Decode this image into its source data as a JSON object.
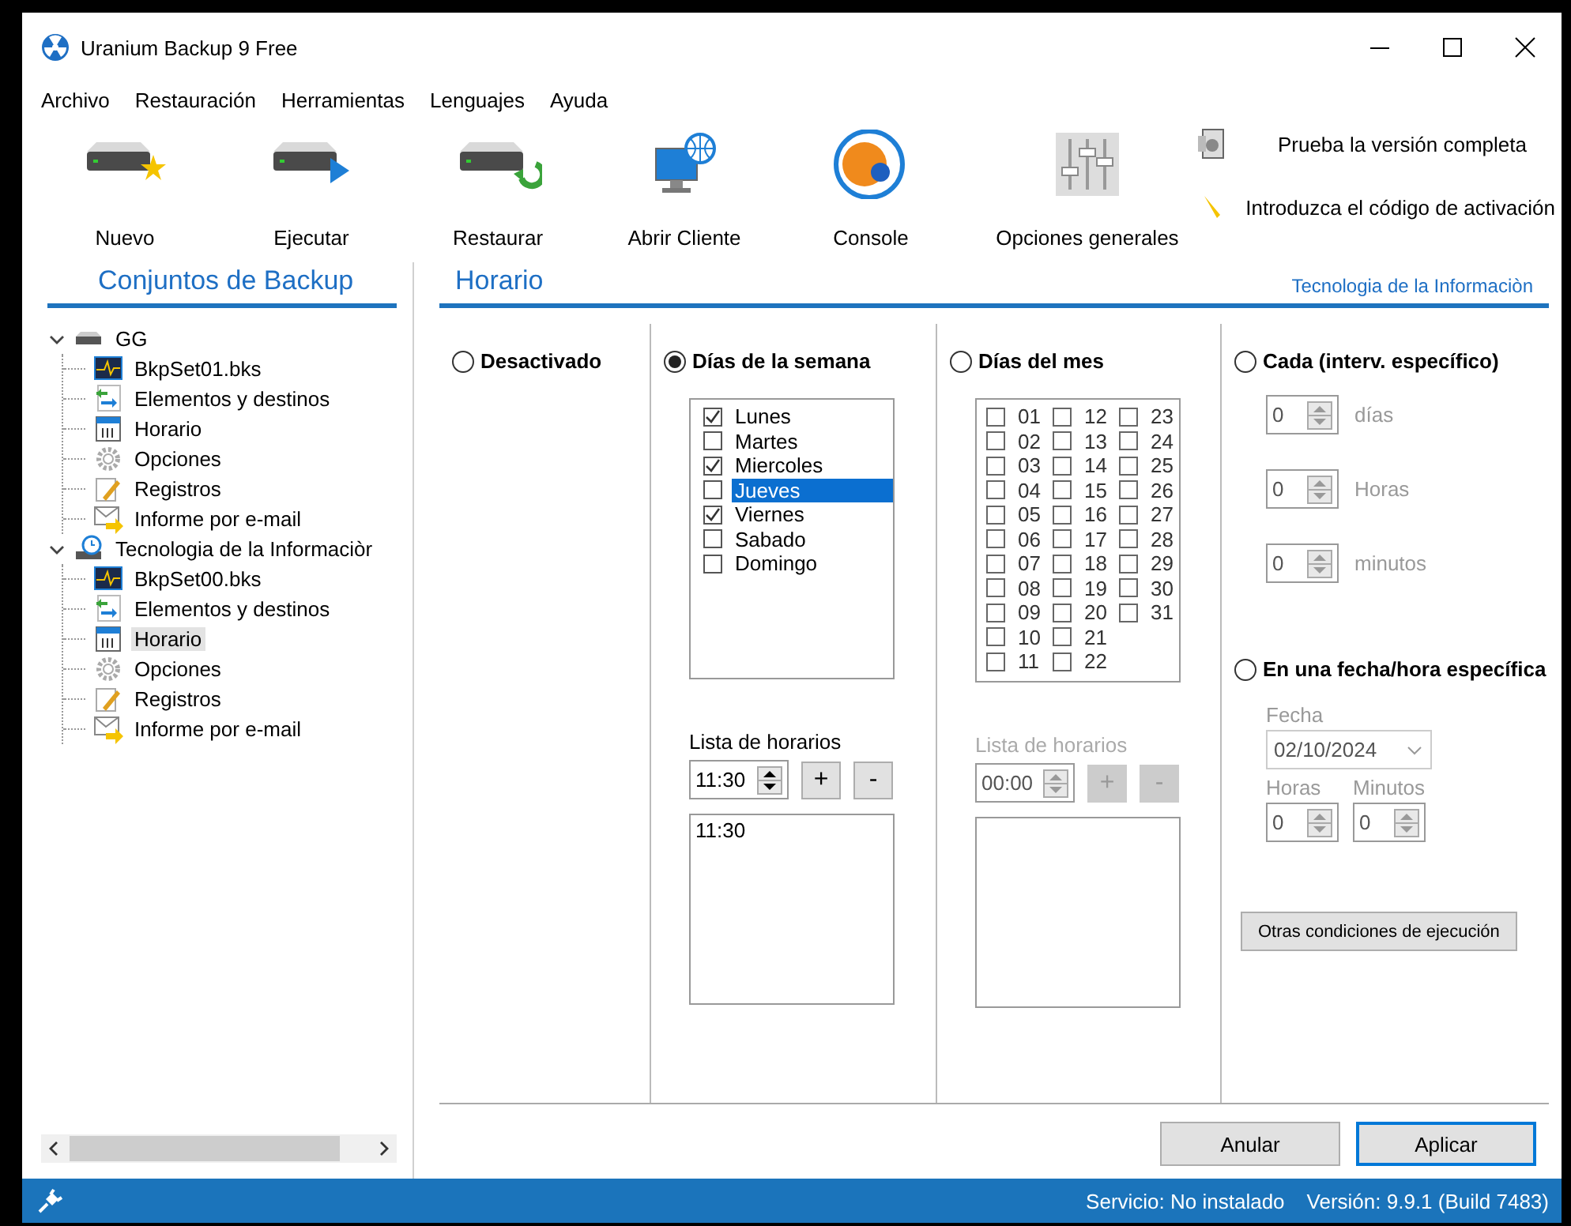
{
  "window": {
    "title": "Uranium Backup 9 Free"
  },
  "menu": [
    "Archivo",
    "Restauración",
    "Herramientas",
    "Lenguajes",
    "Ayuda"
  ],
  "toolbar": [
    {
      "kind": "new",
      "label": "Nuevo"
    },
    {
      "kind": "run",
      "label": "Ejecutar"
    },
    {
      "kind": "restore",
      "label": "Restaurar"
    },
    {
      "kind": "client",
      "label": "Abrir Cliente"
    },
    {
      "kind": "console",
      "label": "Console"
    },
    {
      "kind": "options",
      "label": "Opciones generales"
    }
  ],
  "promo_links": [
    "Prueba la versión completa",
    "Introduzca el código de activación"
  ],
  "sidebar": {
    "title": "Conjuntos de Backup",
    "tree": [
      {
        "kind": "drive",
        "label": "GG",
        "expanded": true,
        "selected": false,
        "children": [
          {
            "kind": "set",
            "label": "BkpSet01.bks",
            "selected": false
          },
          {
            "kind": "items",
            "label": "Elementos y destinos",
            "selected": false
          },
          {
            "kind": "schedule",
            "label": "Horario",
            "selected": false
          },
          {
            "kind": "options",
            "label": "Opciones",
            "selected": false
          },
          {
            "kind": "logs",
            "label": "Registros",
            "selected": false
          },
          {
            "kind": "email",
            "label": "Informe por e-mail",
            "selected": false
          }
        ]
      },
      {
        "kind": "scheduled-drive",
        "label": "Tecnologia de la Informaciòr",
        "expanded": true,
        "selected": false,
        "children": [
          {
            "kind": "set",
            "label": "BkpSet00.bks",
            "selected": false
          },
          {
            "kind": "items",
            "label": "Elementos y destinos",
            "selected": false
          },
          {
            "kind": "schedule",
            "label": "Horario",
            "selected": true
          },
          {
            "kind": "options",
            "label": "Opciones",
            "selected": false
          },
          {
            "kind": "logs",
            "label": "Registros",
            "selected": false
          },
          {
            "kind": "email",
            "label": "Informe por e-mail",
            "selected": false
          }
        ]
      }
    ]
  },
  "panel": {
    "title": "Horario",
    "set_name": "Tecnologia de la Informaciòn",
    "disabled_mode": {
      "label": "Desactivado",
      "selected": false
    },
    "weekdays": {
      "label": "Días de la semana",
      "selected": true,
      "days": [
        {
          "label": "Lunes",
          "checked": true,
          "selected": false
        },
        {
          "label": "Martes",
          "checked": false,
          "selected": false
        },
        {
          "label": "Miercoles",
          "checked": true,
          "selected": false
        },
        {
          "label": "Jueves",
          "checked": false,
          "selected": true
        },
        {
          "label": "Viernes",
          "checked": true,
          "selected": false
        },
        {
          "label": "Sabado",
          "checked": false,
          "selected": false
        },
        {
          "label": "Domingo",
          "checked": false,
          "selected": false
        }
      ],
      "schedule_label": "Lista de horarios",
      "time": "11:30",
      "add_button": "+",
      "remove_button": "-",
      "times": [
        "11:30"
      ]
    },
    "month_days": {
      "label": "Días del mes",
      "selected": false,
      "days": [
        {
          "label": "01",
          "checked": false
        },
        {
          "label": "02",
          "checked": false
        },
        {
          "label": "03",
          "checked": false
        },
        {
          "label": "04",
          "checked": false
        },
        {
          "label": "05",
          "checked": false
        },
        {
          "label": "06",
          "checked": false
        },
        {
          "label": "07",
          "checked": false
        },
        {
          "label": "08",
          "checked": false
        },
        {
          "label": "09",
          "checked": false
        },
        {
          "label": "10",
          "checked": false
        },
        {
          "label": "11",
          "checked": false
        },
        {
          "label": "12",
          "checked": false
        },
        {
          "label": "13",
          "checked": false
        },
        {
          "label": "14",
          "checked": false
        },
        {
          "label": "15",
          "checked": false
        },
        {
          "label": "16",
          "checked": false
        },
        {
          "label": "17",
          "checked": false
        },
        {
          "label": "18",
          "checked": false
        },
        {
          "label": "19",
          "checked": false
        },
        {
          "label": "20",
          "checked": false
        },
        {
          "label": "21",
          "checked": false
        },
        {
          "label": "22",
          "checked": false
        },
        {
          "label": "23",
          "checked": false
        },
        {
          "label": "24",
          "checked": false
        },
        {
          "label": "25",
          "checked": false
        },
        {
          "label": "26",
          "checked": false
        },
        {
          "label": "27",
          "checked": false
        },
        {
          "label": "28",
          "checked": false
        },
        {
          "label": "29",
          "checked": false
        },
        {
          "label": "30",
          "checked": false
        },
        {
          "label": "31",
          "checked": false
        }
      ],
      "schedule_label": "Lista de horarios",
      "time": "00:00",
      "add_button": "+",
      "remove_button": "-"
    },
    "interval": {
      "label": "Cada (interv. específico)",
      "selected": false,
      "fields": [
        {
          "value": "0",
          "unit": "días"
        },
        {
          "value": "0",
          "unit": "Horas"
        },
        {
          "value": "0",
          "unit": "minutos"
        }
      ]
    },
    "specific": {
      "label": "En una fecha/hora específica",
      "selected": false,
      "date_label": "Fecha",
      "date": "02/10/2024",
      "hour_label": "Horas",
      "hour": "0",
      "minute_label": "Minutos",
      "minute": "0"
    },
    "other_conditions_button": "Otras condiciones de ejecución"
  },
  "buttons": [
    {
      "label": "Anular",
      "default": false
    },
    {
      "label": "Aplicar",
      "default": true
    }
  ],
  "status_bar": {
    "service": "Servicio: No instalado",
    "version": "Versión: 9.9.1 (Build 7483)"
  }
}
